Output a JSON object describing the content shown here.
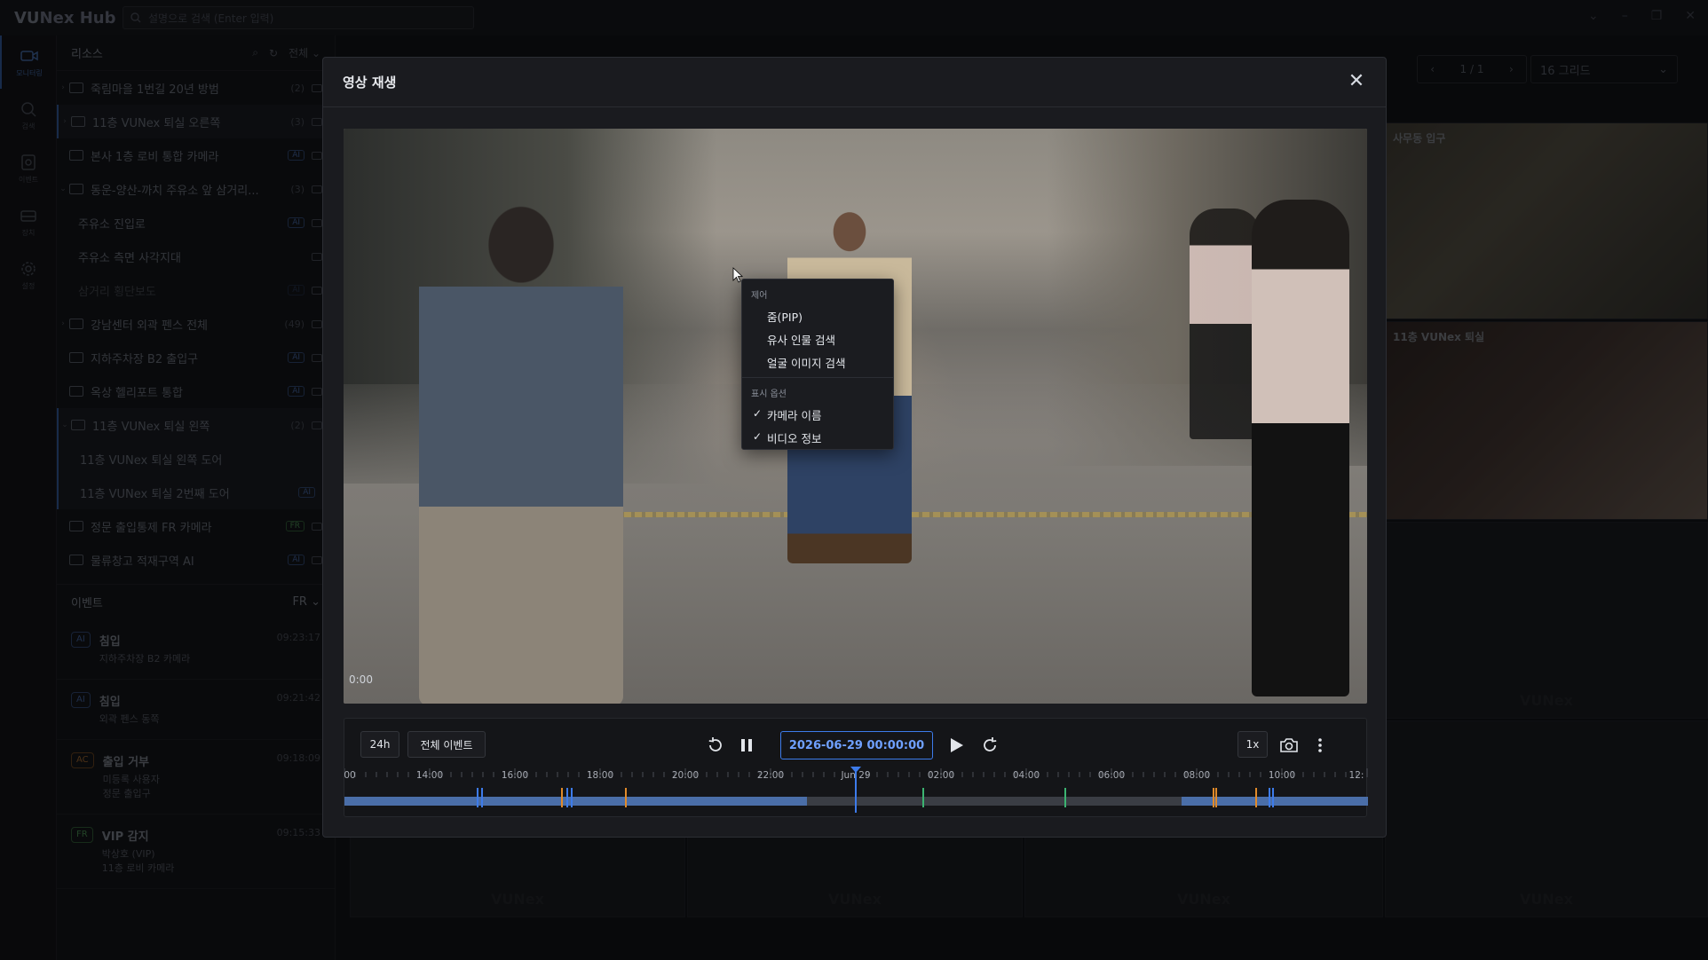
{
  "app": {
    "brand_prefix": "VU",
    "brand_suffix": "Nex Hub",
    "search_placeholder": "설명으로 검색 (Enter 입력)"
  },
  "rail": [
    {
      "label": "모니터링",
      "icon": "video-camera-icon"
    },
    {
      "label": "검색",
      "icon": "search-icon"
    },
    {
      "label": "이벤트",
      "icon": "event-icon"
    },
    {
      "label": "장치",
      "icon": "device-icon"
    },
    {
      "label": "설정",
      "icon": "gear-icon"
    }
  ],
  "sidebar": {
    "title": "리소스",
    "filter": "전체",
    "items": [
      {
        "label": "죽림마을 1번길 20년 방범",
        "count": "(2)",
        "badge": ""
      },
      {
        "label": "11층 VUNex 퇴실 오른쪽",
        "count": "(3)",
        "badge": ""
      },
      {
        "label": "본사 1층 로비 통합 카메라",
        "count": "",
        "badge": "AI"
      },
      {
        "label": "동운-양산-까치 주유소 앞 삼거리...",
        "count": "(3)",
        "badge": ""
      },
      {
        "label": "주유소 진입로",
        "count": "",
        "badge": "AI"
      },
      {
        "label": "주유소 측면 사각지대",
        "count": "",
        "badge": ""
      },
      {
        "label": "삼거리 횡단보도",
        "count": "",
        "badge": "AI"
      },
      {
        "label": "강남센터 외곽 펜스 전체",
        "count": "(49)",
        "badge": ""
      },
      {
        "label": "지하주차장 B2 출입구",
        "count": "",
        "badge": "AI"
      },
      {
        "label": "옥상 헬리포트 통합",
        "count": "",
        "badge": "AI"
      },
      {
        "label": "11층 VUNex 퇴실 왼쪽",
        "count": "(2)",
        "badge": ""
      },
      {
        "label": "11층 VUNex 퇴실 왼쪽 도어",
        "count": "",
        "badge": ""
      },
      {
        "label": "11층 VUNex 퇴실 2번째 도어",
        "count": "",
        "badge": "AI"
      },
      {
        "label": "정문 출입통제 FR 카메라",
        "count": "",
        "badge": "FR"
      },
      {
        "label": "물류창고 적재구역 AI",
        "count": "",
        "badge": "AI"
      }
    ],
    "events_title": "이벤트",
    "events_filter": "FR",
    "events": [
      {
        "badge": "AI",
        "title": "침입",
        "line1": "지하주차장 B2 카메라",
        "line2": "",
        "time": "09:23:17"
      },
      {
        "badge": "AI",
        "title": "침입",
        "line1": "외곽 펜스 동쪽",
        "line2": "",
        "time": "09:21:42"
      },
      {
        "badge": "AC",
        "title": "출입 거부",
        "line1": "미등록 사용자",
        "line2": "정문 출입구",
        "time": "09:18:09"
      },
      {
        "badge": "FR",
        "title": "VIP 감지",
        "line1": "박상호 (VIP)",
        "line2": "11층 로비 카메라",
        "time": "09:15:33"
      }
    ]
  },
  "main": {
    "page": "1 / 1",
    "grid_select": "16 그리드",
    "tile1_label": "사무동 입구",
    "tile2_label": "11층 VUNex 퇴실",
    "watermark": "VUNex"
  },
  "modal": {
    "title": "영상 재생",
    "video_time": "0:00",
    "context_menu": {
      "section1": "제어",
      "items1": [
        "줌(PIP)",
        "유사 인물 검색",
        "얼굴 이미지 검색"
      ],
      "section2": "표시 옵션",
      "items2": [
        "카메라 이름",
        "비디오 정보"
      ],
      "checked": [
        true,
        true
      ]
    },
    "controls": {
      "range_label": "24h",
      "events_label": "전체 이벤트",
      "datetime": "2026-06-29 00:00:00",
      "speed": "1x"
    },
    "timeline": {
      "labels": [
        "00",
        "14:00",
        "16:00",
        "18:00",
        "20:00",
        "22:00",
        "Jun 29",
        "02:00",
        "04:00",
        "06:00",
        "08:00",
        "10:00",
        "12:"
      ],
      "event_colors": {
        "ai": "#3d7bea",
        "ac": "#e08a2a",
        "fr": "#3cb371"
      }
    }
  }
}
